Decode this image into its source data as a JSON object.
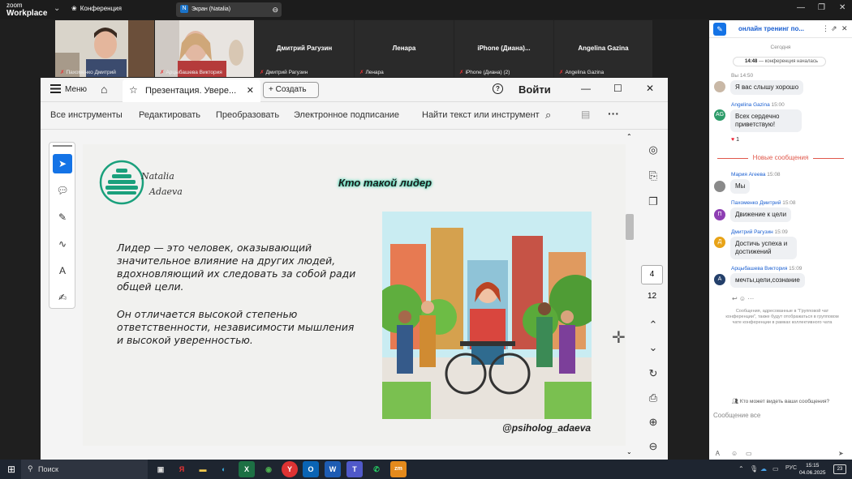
{
  "app": {
    "brand_top": "zoom",
    "brand_bottom": "Workplace",
    "conference_label": "Конференция",
    "share_label": "Экран (Natalia)",
    "share_badge": "N"
  },
  "participants": [
    {
      "label": "Пахоменко Дмитрий",
      "name": "",
      "video": true
    },
    {
      "label": "Арцыбашева Виктория",
      "name": "",
      "video": true
    },
    {
      "label": "Дмитрий Рагузин",
      "name": "Дмитрий Рагузин",
      "video": false
    },
    {
      "label": "Ленара",
      "name": "Ленара",
      "video": false
    },
    {
      "label": "iPhone (Диана) (2)",
      "name": "iPhone  (Диана)...",
      "video": false
    },
    {
      "label": "Angelina Gazina",
      "name": "Angelina Gazina",
      "video": false
    }
  ],
  "pdf": {
    "menu": "Меню",
    "tab_title": "Презентация. Увере...",
    "create": "Создать",
    "login": "Войти",
    "toolbar": [
      "Все инструменты",
      "Редактировать",
      "Преобразовать",
      "Электронное подписание",
      "Найти текст или инструмент"
    ],
    "page_current": "4",
    "page_total": "12"
  },
  "slide": {
    "logo_line1": "Natalia",
    "logo_line2": "Adaeva",
    "title": "Кто такой лидер",
    "para1_em": "Лидер",
    "para1_rest": " — это человек, оказывающий значительное влияние на других людей, вдохновляющий их следовать за собой ради общей цели.",
    "para2": "Он отличается высокой степенью ответственности, независимости мышления и высокой уверенностью.",
    "handle": "@psiholog_adaeva"
  },
  "chat": {
    "title": "онлайн тренинг по...",
    "today": "Сегодня",
    "started_time": "14:48",
    "started_text": "— конференция началась",
    "messages": [
      {
        "meta_name": "Вы",
        "meta_time": "14:50",
        "text": "Я вас слышу хорошо",
        "avatar": "",
        "avatar_color": "#c9b8a6"
      },
      {
        "meta_name": "Angelina Gazina",
        "meta_time": "15:00",
        "text": "Всех сердечно приветствую!",
        "avatar": "AG",
        "avatar_color": "#2e9c6a"
      },
      {
        "meta_name": "Мария Агеева",
        "meta_time": "15:08",
        "text": "Мы",
        "avatar": "",
        "avatar_color": "#8a8a8a"
      },
      {
        "meta_name": "Пахоменко Дмитрий",
        "meta_time": "15:08",
        "text": "Движение к цели",
        "avatar": "П",
        "avatar_color": "#8e3fb3"
      },
      {
        "meta_name": "Дмитрий Рагузин",
        "meta_time": "15:09",
        "text": "Достичь успеха и достижений",
        "avatar": "Д",
        "avatar_color": "#e8a317"
      },
      {
        "meta_name": "Арцыбашева Виктория",
        "meta_time": "15:09",
        "text": "мечты,цели,сознание",
        "avatar": "А",
        "avatar_color": "#24406b"
      }
    ],
    "reaction_count": "1",
    "new_messages": "Новые сообщения",
    "notice": "Сообщения, адресованные в \"Групповой чат конференции\", также будут отображаться в групповом чате конференции в рамках коллективного чата",
    "who_sees": "Кто может видеть ваши сообщения?",
    "composer_placeholder": "Сообщение все"
  },
  "taskbar": {
    "search": "Поиск",
    "lang": "РУС",
    "time": "15:15",
    "date": "04.06.2025",
    "notif": "23"
  }
}
